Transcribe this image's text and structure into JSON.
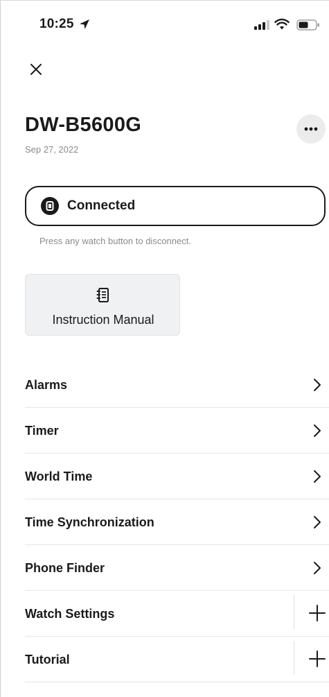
{
  "status_bar": {
    "time": "10:25"
  },
  "device": {
    "title": "DW-B5600G",
    "date": "Sep 27, 2022"
  },
  "connection": {
    "status": "Connected",
    "hint": "Press any watch button to disconnect."
  },
  "manual": {
    "label": "Instruction Manual"
  },
  "menu": {
    "alarms": "Alarms",
    "timer": "Timer",
    "world_time": "World Time",
    "time_sync": "Time Synchronization",
    "phone_finder": "Phone Finder",
    "watch_settings": "Watch Settings",
    "tutorial": "Tutorial"
  },
  "icons": {
    "location": "location-arrow-icon",
    "signal": "cellular-signal-icon",
    "wifi": "wifi-icon",
    "battery": "battery-icon",
    "close": "close-icon",
    "more": "more-horizontal-icon",
    "watch": "watch-icon",
    "manual": "manual-book-icon",
    "chevron": "chevron-right-icon",
    "plus": "plus-icon"
  },
  "colors": {
    "text": "#1a1a1a",
    "muted": "#8a8a8a",
    "card_bg": "#f0f1f3",
    "divider": "#e6e6e6"
  }
}
